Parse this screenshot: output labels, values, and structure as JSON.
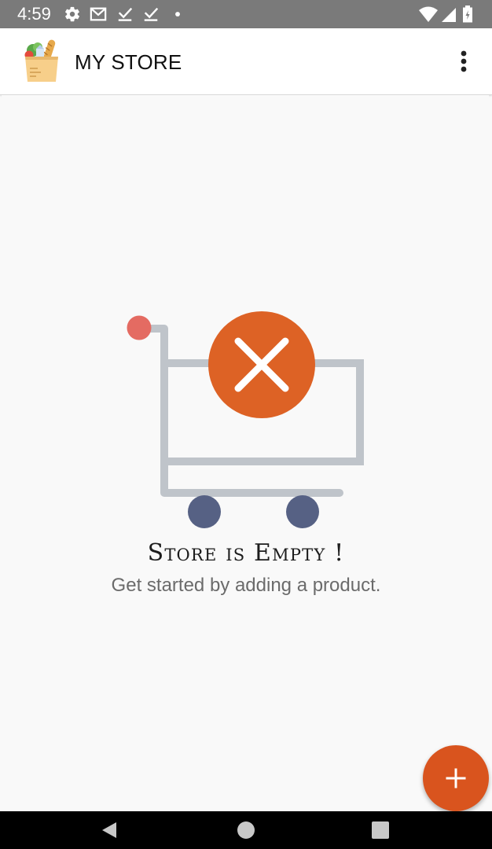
{
  "status_bar": {
    "time": "4:59",
    "left_icons": [
      "settings-icon",
      "gmail-icon",
      "check-download-icon",
      "check-download-icon",
      "dot-icon"
    ],
    "right_icons": [
      "wifi-icon",
      "cell-signal-icon",
      "battery-icon"
    ]
  },
  "app_bar": {
    "logo_icon": "grocery-bag-icon",
    "title": "MY STORE",
    "menu_icon": "more-vert-icon"
  },
  "empty_state": {
    "illustration": "empty-cart-icon",
    "title": "Store is Empty !",
    "subtitle": "Get started by adding a product."
  },
  "fab": {
    "icon": "plus-icon"
  },
  "nav_bar": {
    "buttons": [
      "back-icon",
      "home-icon",
      "recents-icon"
    ]
  },
  "colors": {
    "accent": "#d9541e",
    "status_bar": "#7a7a7a",
    "cart_gray": "#bfc4ca",
    "wheel": "#566184",
    "handle_dot": "#e46b62"
  }
}
